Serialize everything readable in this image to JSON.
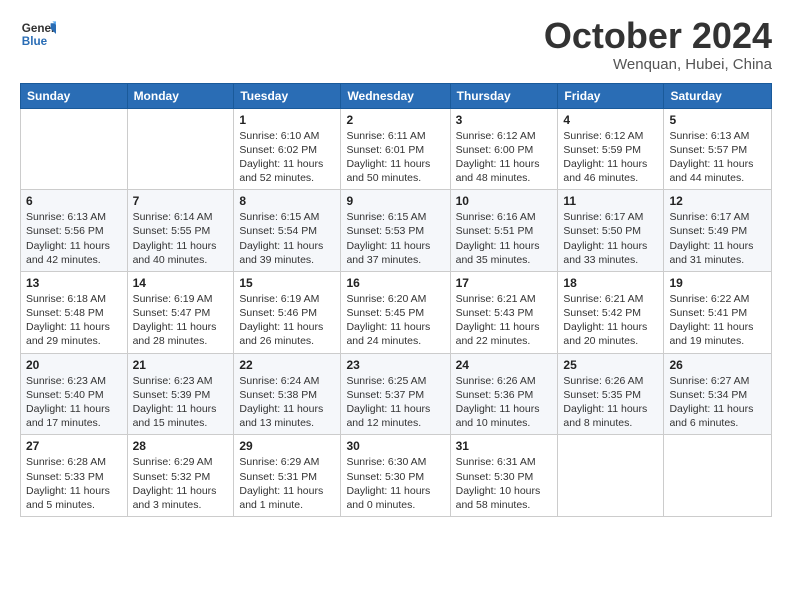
{
  "header": {
    "logo_line1": "General",
    "logo_line2": "Blue",
    "month": "October 2024",
    "location": "Wenquan, Hubei, China"
  },
  "days_of_week": [
    "Sunday",
    "Monday",
    "Tuesday",
    "Wednesday",
    "Thursday",
    "Friday",
    "Saturday"
  ],
  "weeks": [
    [
      {
        "day": "",
        "info": ""
      },
      {
        "day": "",
        "info": ""
      },
      {
        "day": "1",
        "info": "Sunrise: 6:10 AM\nSunset: 6:02 PM\nDaylight: 11 hours and 52 minutes."
      },
      {
        "day": "2",
        "info": "Sunrise: 6:11 AM\nSunset: 6:01 PM\nDaylight: 11 hours and 50 minutes."
      },
      {
        "day": "3",
        "info": "Sunrise: 6:12 AM\nSunset: 6:00 PM\nDaylight: 11 hours and 48 minutes."
      },
      {
        "day": "4",
        "info": "Sunrise: 6:12 AM\nSunset: 5:59 PM\nDaylight: 11 hours and 46 minutes."
      },
      {
        "day": "5",
        "info": "Sunrise: 6:13 AM\nSunset: 5:57 PM\nDaylight: 11 hours and 44 minutes."
      }
    ],
    [
      {
        "day": "6",
        "info": "Sunrise: 6:13 AM\nSunset: 5:56 PM\nDaylight: 11 hours and 42 minutes."
      },
      {
        "day": "7",
        "info": "Sunrise: 6:14 AM\nSunset: 5:55 PM\nDaylight: 11 hours and 40 minutes."
      },
      {
        "day": "8",
        "info": "Sunrise: 6:15 AM\nSunset: 5:54 PM\nDaylight: 11 hours and 39 minutes."
      },
      {
        "day": "9",
        "info": "Sunrise: 6:15 AM\nSunset: 5:53 PM\nDaylight: 11 hours and 37 minutes."
      },
      {
        "day": "10",
        "info": "Sunrise: 6:16 AM\nSunset: 5:51 PM\nDaylight: 11 hours and 35 minutes."
      },
      {
        "day": "11",
        "info": "Sunrise: 6:17 AM\nSunset: 5:50 PM\nDaylight: 11 hours and 33 minutes."
      },
      {
        "day": "12",
        "info": "Sunrise: 6:17 AM\nSunset: 5:49 PM\nDaylight: 11 hours and 31 minutes."
      }
    ],
    [
      {
        "day": "13",
        "info": "Sunrise: 6:18 AM\nSunset: 5:48 PM\nDaylight: 11 hours and 29 minutes."
      },
      {
        "day": "14",
        "info": "Sunrise: 6:19 AM\nSunset: 5:47 PM\nDaylight: 11 hours and 28 minutes."
      },
      {
        "day": "15",
        "info": "Sunrise: 6:19 AM\nSunset: 5:46 PM\nDaylight: 11 hours and 26 minutes."
      },
      {
        "day": "16",
        "info": "Sunrise: 6:20 AM\nSunset: 5:45 PM\nDaylight: 11 hours and 24 minutes."
      },
      {
        "day": "17",
        "info": "Sunrise: 6:21 AM\nSunset: 5:43 PM\nDaylight: 11 hours and 22 minutes."
      },
      {
        "day": "18",
        "info": "Sunrise: 6:21 AM\nSunset: 5:42 PM\nDaylight: 11 hours and 20 minutes."
      },
      {
        "day": "19",
        "info": "Sunrise: 6:22 AM\nSunset: 5:41 PM\nDaylight: 11 hours and 19 minutes."
      }
    ],
    [
      {
        "day": "20",
        "info": "Sunrise: 6:23 AM\nSunset: 5:40 PM\nDaylight: 11 hours and 17 minutes."
      },
      {
        "day": "21",
        "info": "Sunrise: 6:23 AM\nSunset: 5:39 PM\nDaylight: 11 hours and 15 minutes."
      },
      {
        "day": "22",
        "info": "Sunrise: 6:24 AM\nSunset: 5:38 PM\nDaylight: 11 hours and 13 minutes."
      },
      {
        "day": "23",
        "info": "Sunrise: 6:25 AM\nSunset: 5:37 PM\nDaylight: 11 hours and 12 minutes."
      },
      {
        "day": "24",
        "info": "Sunrise: 6:26 AM\nSunset: 5:36 PM\nDaylight: 11 hours and 10 minutes."
      },
      {
        "day": "25",
        "info": "Sunrise: 6:26 AM\nSunset: 5:35 PM\nDaylight: 11 hours and 8 minutes."
      },
      {
        "day": "26",
        "info": "Sunrise: 6:27 AM\nSunset: 5:34 PM\nDaylight: 11 hours and 6 minutes."
      }
    ],
    [
      {
        "day": "27",
        "info": "Sunrise: 6:28 AM\nSunset: 5:33 PM\nDaylight: 11 hours and 5 minutes."
      },
      {
        "day": "28",
        "info": "Sunrise: 6:29 AM\nSunset: 5:32 PM\nDaylight: 11 hours and 3 minutes."
      },
      {
        "day": "29",
        "info": "Sunrise: 6:29 AM\nSunset: 5:31 PM\nDaylight: 11 hours and 1 minute."
      },
      {
        "day": "30",
        "info": "Sunrise: 6:30 AM\nSunset: 5:30 PM\nDaylight: 11 hours and 0 minutes."
      },
      {
        "day": "31",
        "info": "Sunrise: 6:31 AM\nSunset: 5:30 PM\nDaylight: 10 hours and 58 minutes."
      },
      {
        "day": "",
        "info": ""
      },
      {
        "day": "",
        "info": ""
      }
    ]
  ]
}
